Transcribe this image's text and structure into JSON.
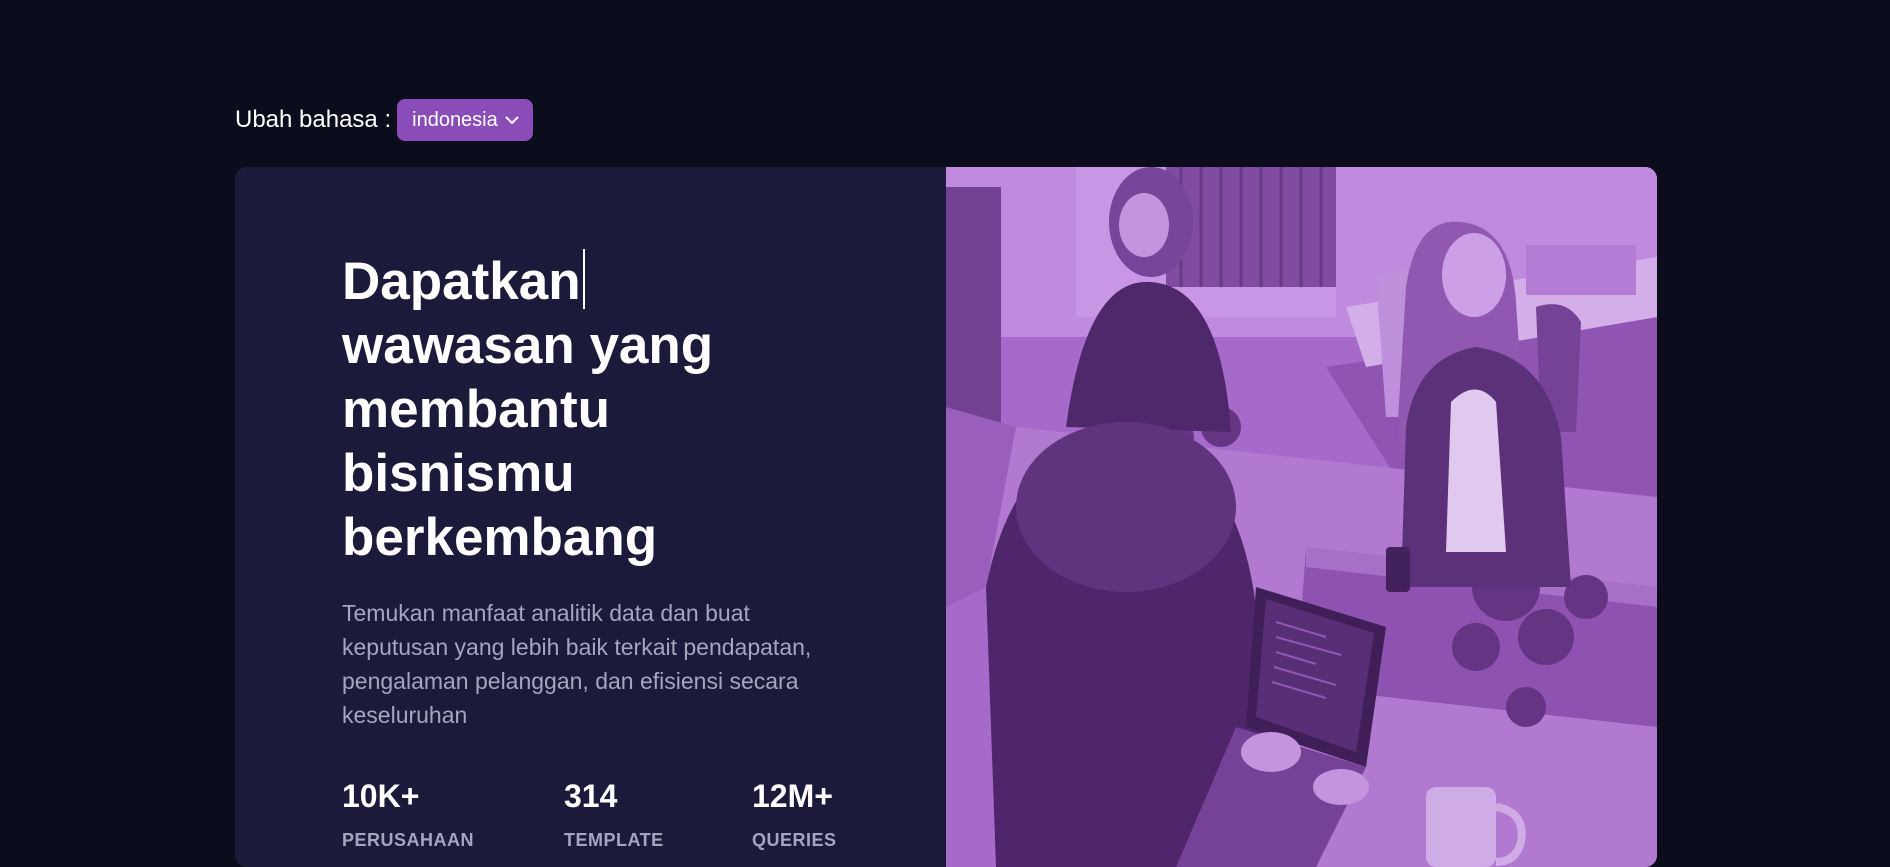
{
  "language_switcher": {
    "label": "Ubah bahasa :",
    "selected": "indonesia"
  },
  "hero": {
    "headline": "Dapatkan wawasan yang membantu bisnismu berkembang",
    "description": "Temukan manfaat analitik data dan buat keputusan yang lebih baik terkait pendapatan, pengalaman pelanggan, dan efisiensi secara keseluruhan",
    "stats": [
      {
        "value": "10K+",
        "label": "PERUSAHAAN"
      },
      {
        "value": "314",
        "label": "TEMPLATE"
      },
      {
        "value": "12M+",
        "label": "QUERIES"
      }
    ],
    "image_icon": "office-team-photo"
  },
  "colors": {
    "background": "#0b0d1c",
    "card": "#1c1a3a",
    "accent": "#8a4cb8",
    "photo_tint": "#a56bc7",
    "muted_text": "#a6a5bf"
  }
}
